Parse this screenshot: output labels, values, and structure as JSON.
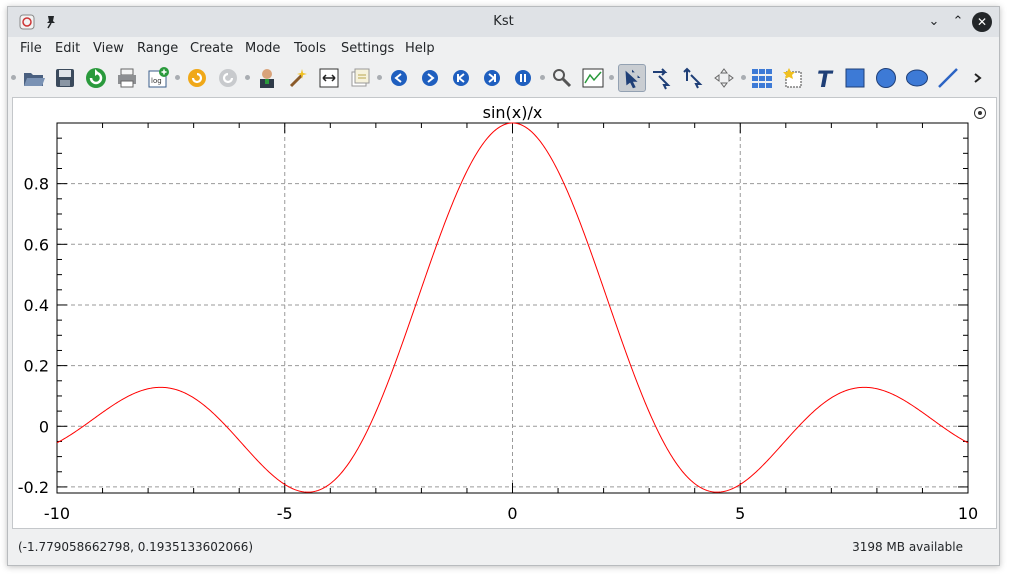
{
  "window": {
    "title": "Kst"
  },
  "menu": [
    "File",
    "Edit",
    "View",
    "Range",
    "Create",
    "Mode",
    "Tools",
    "Settings",
    "Help"
  ],
  "toolbar": {
    "icons": [
      "open-icon",
      "save-icon",
      "reload-icon",
      "print-icon",
      "export-log-icon",
      "undo-icon",
      "redo-icon",
      "data-manager-icon",
      "data-wizard-icon",
      "change-range-icon",
      "edit-multiple-icon",
      "back-icon",
      "forward-icon",
      "back-step-icon",
      "forward-step-icon",
      "pause-icon",
      "zoom-to-fit-icon",
      "plot-wizard-icon",
      "layout-mode-icon",
      "zoom-mode-icon",
      "pick-mode-icon",
      "pan-mode-icon",
      "layout-grid-icon",
      "label-icon",
      "text-icon",
      "box-icon",
      "circle-icon",
      "ellipse-icon",
      "line-icon",
      "more-icon"
    ]
  },
  "chart_data": {
    "type": "line",
    "title": "sin(x)/x",
    "xlabel": "",
    "ylabel": "",
    "xlim": [
      -10,
      10
    ],
    "ylim": [
      -0.22,
      1.0
    ],
    "x_ticks": [
      "-10",
      "-5",
      "0",
      "5",
      "10"
    ],
    "y_ticks": [
      "-0.2",
      "0",
      "0.2",
      "0.4",
      "0.6",
      "0.8"
    ],
    "grid": true,
    "series": [
      {
        "function": "sin(x)/x",
        "color": "#ff0000",
        "x_range": [
          -10,
          10
        ]
      }
    ]
  },
  "status": {
    "coordinates": "(-1.779058662798, 0.1935133602066)",
    "memory": "3198 MB available"
  }
}
